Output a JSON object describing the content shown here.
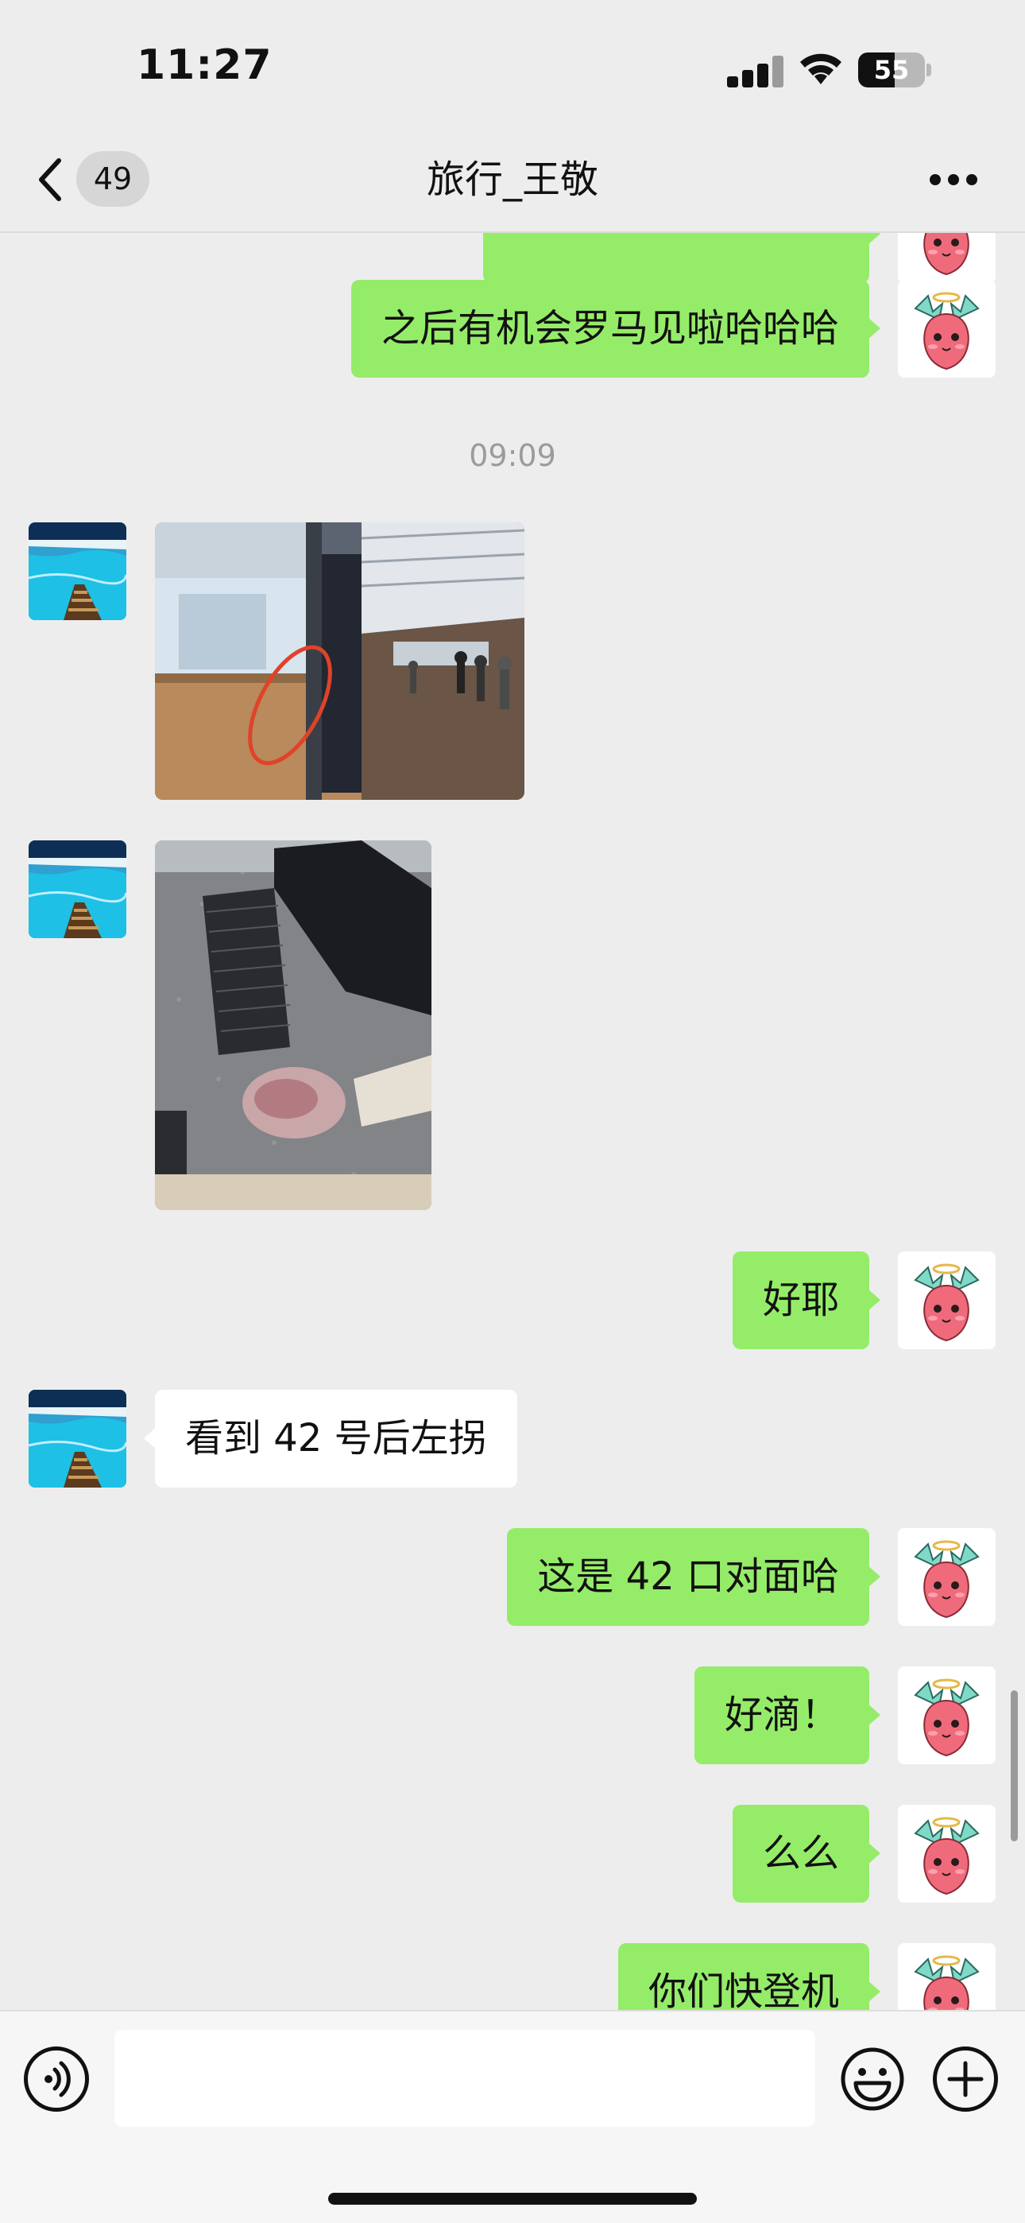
{
  "status_bar": {
    "time": "11:27",
    "battery_text": "55",
    "battery_level_percent": 55
  },
  "nav": {
    "back_badge": "49",
    "title": "旅行_王敬"
  },
  "messages": [
    {
      "from": "me",
      "type": "text",
      "text": "之后有机会罗马见啦哈哈哈"
    },
    {
      "type": "timestamp",
      "text": "09:09"
    },
    {
      "from": "them",
      "type": "image",
      "subject": "airport gate counter with red circle"
    },
    {
      "from": "them",
      "type": "image",
      "subject": "desk with keyboard and bag"
    },
    {
      "from": "me",
      "type": "text",
      "text": "好耶"
    },
    {
      "from": "them",
      "type": "text",
      "text": "看到 42 号后左拐"
    },
    {
      "from": "me",
      "type": "text",
      "text": "这是 42 口对面哈"
    },
    {
      "from": "me",
      "type": "text",
      "text": "好滴！"
    },
    {
      "from": "me",
      "type": "text",
      "text": "么么"
    },
    {
      "from": "me",
      "type": "text",
      "text": "你们快登机"
    }
  ],
  "input_bar": {
    "placeholder": "",
    "value": ""
  },
  "icons": {
    "back": "chevron-left-icon",
    "more": "more-icon",
    "voice": "voice-icon",
    "emoji": "emoji-icon",
    "plus": "plus-icon"
  },
  "colors": {
    "background": "#ededed",
    "my_bubble": "#95ec69",
    "their_bubble": "#ffffff",
    "timestamp": "#9b9b9b"
  }
}
